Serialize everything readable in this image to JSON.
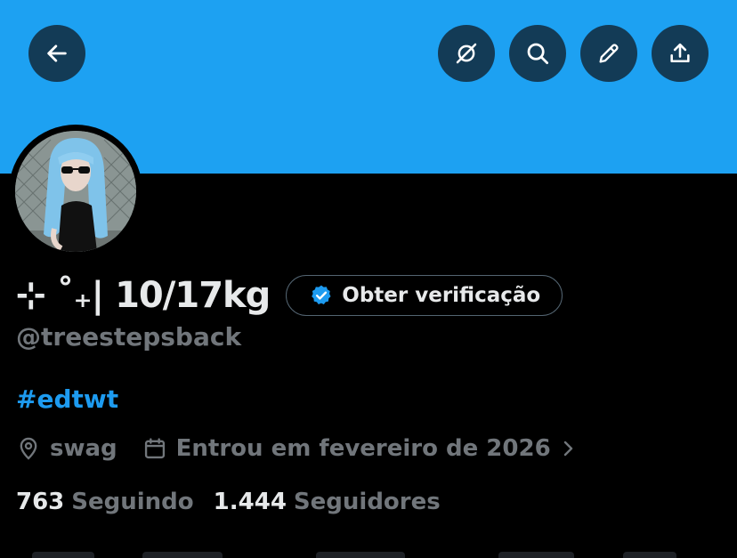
{
  "header": {
    "back_icon": "arrow-left-icon",
    "actions": [
      {
        "name": "unmute",
        "icon": "eye-slash-icon"
      },
      {
        "name": "search",
        "icon": "search-icon"
      },
      {
        "name": "edit",
        "icon": "pencil-icon"
      },
      {
        "name": "share",
        "icon": "share-icon"
      }
    ]
  },
  "colors": {
    "banner": "#1da1f2",
    "accent": "#1d9bf0",
    "secondary_text": "#71767b",
    "primary_text": "#e7e9ea",
    "background": "#000000"
  },
  "profile": {
    "display_name": "⊹ ˚₊| 10/17kg",
    "verify_label": "Obter verificação",
    "handle": "@treestepsback",
    "bio": "#edtwt",
    "location": "swag",
    "joined": "Entrou em fevereiro de 2026",
    "following_count": "763",
    "following_label": "Seguindo",
    "followers_count": "1.444",
    "followers_label": "Seguidores"
  }
}
